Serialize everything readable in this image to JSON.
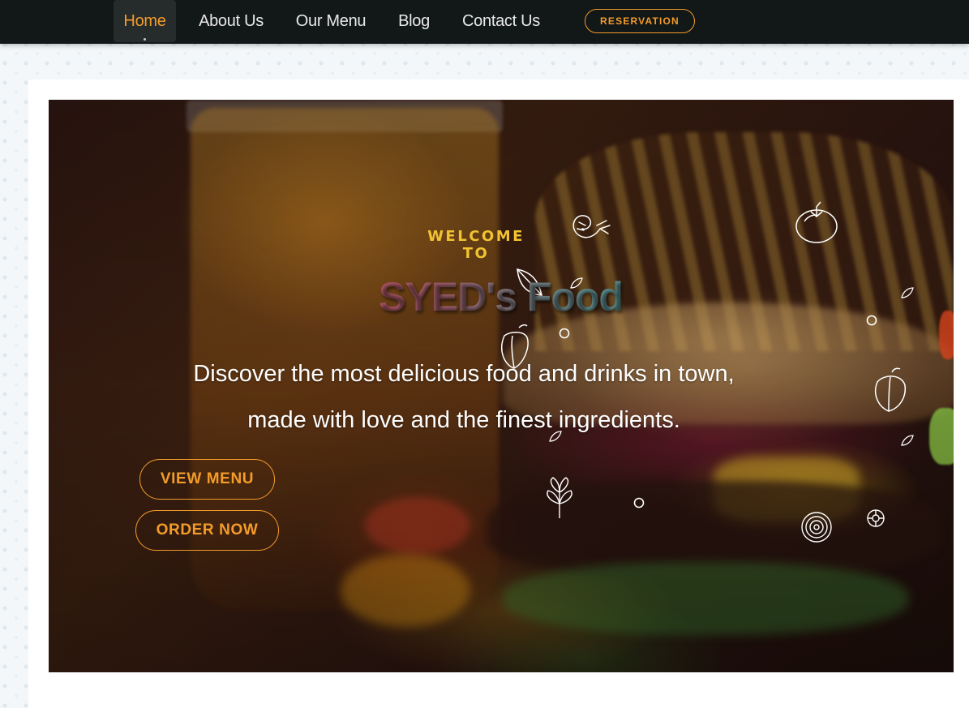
{
  "nav": {
    "items": [
      {
        "label": "Home",
        "active": true
      },
      {
        "label": "About Us",
        "active": false
      },
      {
        "label": "Our Menu",
        "active": false
      },
      {
        "label": "Blog",
        "active": false
      },
      {
        "label": "Contact Us",
        "active": false
      }
    ],
    "reservation_label": "RESERVATION"
  },
  "hero": {
    "welcome": "WELCOME TO",
    "title": "SYED's Food",
    "tagline_line1": "Discover the most delicious food and drinks in town,",
    "tagline_line2": "made with love and the finest ingredients.",
    "view_menu_label": "VIEW MENU",
    "order_now_label": "ORDER NOW",
    "doodle_icons": [
      "shrimp-icon",
      "tomato-icon",
      "leaf-icon",
      "pepper-icon",
      "circle-icon",
      "herb-icon",
      "onion-icon"
    ]
  },
  "colors": {
    "navbar_bg": "#121718",
    "accent": "#f39c2a",
    "welcome_gold": "#f1c232",
    "title_gradient_start": "#b84a5c",
    "title_gradient_end": "#3e9a98"
  }
}
